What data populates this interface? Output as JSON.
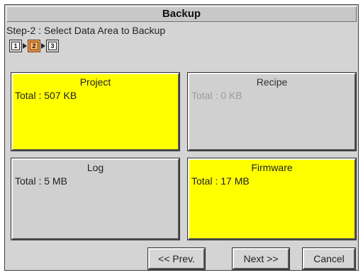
{
  "window": {
    "title": "Backup"
  },
  "step": {
    "label": "Step-2 : Select Data Area to Backup",
    "steps": [
      "1",
      "2",
      "3"
    ],
    "current": 2
  },
  "areas": [
    {
      "name": "Project",
      "total": "Total : 507 KB",
      "selected": true,
      "enabled": true
    },
    {
      "name": "Recipe",
      "total": "Total : 0 KB",
      "selected": false,
      "enabled": false
    },
    {
      "name": "Log",
      "total": "Total : 5 MB",
      "selected": false,
      "enabled": true
    },
    {
      "name": "Firmware",
      "total": "Total : 17 MB",
      "selected": true,
      "enabled": true
    }
  ],
  "buttons": {
    "prev": "<< Prev.",
    "next": "Next >>",
    "cancel": "Cancel"
  },
  "colors": {
    "selected": "#ffff00",
    "unselected": "#d0d0d0",
    "active_step": "#f7b46a",
    "panel": "#d4d4d4"
  }
}
